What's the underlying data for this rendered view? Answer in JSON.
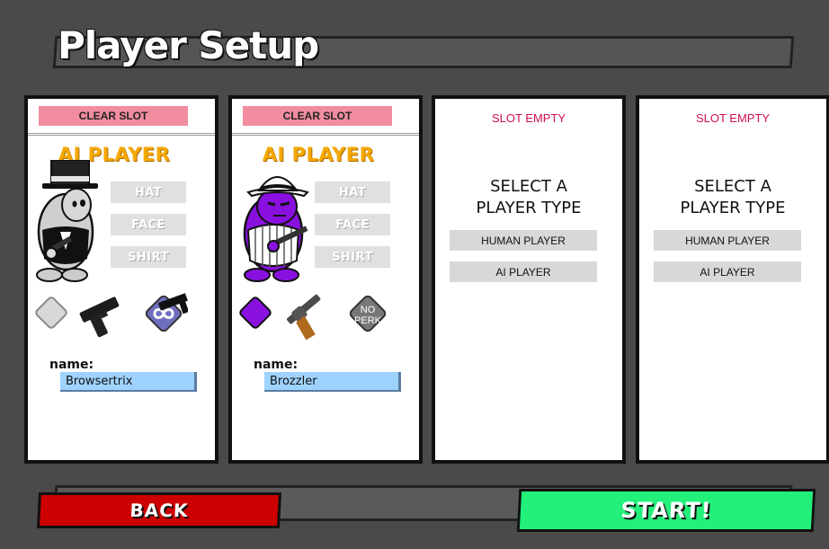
{
  "title": "Player Setup",
  "slots": [
    {
      "clear_label": "CLEAR SLOT",
      "player_type": "AI PLAYER",
      "hat_label": "HAT",
      "face_label": "FACE",
      "shirt_label": "SHIRT",
      "name_label": "name:",
      "name_value": "Browsertrix",
      "color": "#d8d8d8",
      "weapon": "pistol-icon",
      "perk": "infinity-perk-icon"
    },
    {
      "clear_label": "CLEAR SLOT",
      "player_type": "AI PLAYER",
      "hat_label": "HAT",
      "face_label": "FACE",
      "shirt_label": "SHIRT",
      "name_label": "name:",
      "name_value": "Brozzler",
      "color": "#8a10e0",
      "weapon": "revolver-icon",
      "perk_text_line1": "NO",
      "perk_text_line2": "PERK"
    },
    {
      "status": "SLOT EMPTY",
      "prompt_line1": "SELECT A",
      "prompt_line2": "PLAYER TYPE",
      "human_label": "HUMAN PLAYER",
      "ai_label": "AI PLAYER"
    },
    {
      "status": "SLOT EMPTY",
      "prompt_line1": "SELECT A",
      "prompt_line2": "PLAYER TYPE",
      "human_label": "HUMAN PLAYER",
      "ai_label": "AI PLAYER"
    }
  ],
  "back_label": "BACK",
  "start_label": "START!",
  "colors": {
    "background": "#4a4a4a",
    "clear_slot": "#f28da0",
    "ai_title": "#f5a800",
    "slot_empty": "#d0104c",
    "back": "#cc0000",
    "start": "#22f07a",
    "name_field": "#9fd3ff"
  }
}
